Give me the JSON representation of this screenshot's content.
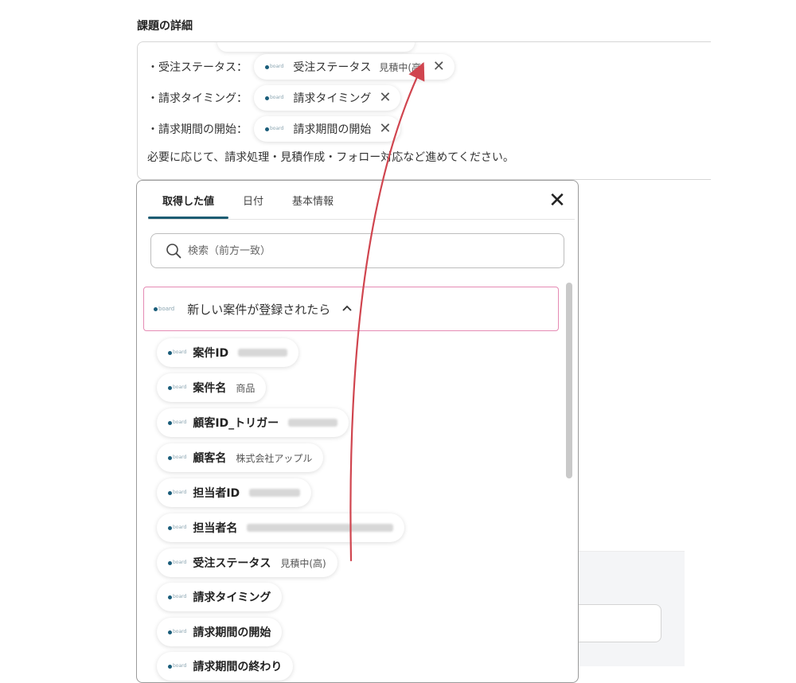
{
  "section_title": "課題の詳細",
  "detail": {
    "lines": [
      {
        "label": "・受注ステータス：",
        "pill": "受注ステータス",
        "sub": "見積中(高)"
      },
      {
        "label": "・請求タイミング：",
        "pill": "請求タイミング",
        "sub": ""
      },
      {
        "label": "・請求期間の開始：",
        "pill": "請求期間の開始",
        "sub": ""
      }
    ],
    "note": "必要に応じて、請求処理・見積作成・フォロー対応など進めてください。",
    "remove_glyph": "✕"
  },
  "logo_text": "board",
  "popup": {
    "tabs": [
      "取得した値",
      "日付",
      "基本情報"
    ],
    "active_tab": 0,
    "close_glyph": "✕",
    "search_placeholder": "検索（前方一致）",
    "group_title": "新しい案件が登録されたら",
    "group_chevron": "^",
    "items": [
      {
        "name": "案件ID",
        "value": ""
      },
      {
        "name": "案件名",
        "value": "商品"
      },
      {
        "name": "顧客ID_トリガー",
        "value": ""
      },
      {
        "name": "顧客名",
        "value": "株式会社アップル"
      },
      {
        "name": "担当者ID",
        "value": ""
      },
      {
        "name": "担当者名",
        "value": ""
      },
      {
        "name": "受注ステータス",
        "value": "見積中(高)"
      },
      {
        "name": "請求タイミング",
        "value": ""
      },
      {
        "name": "請求期間の開始",
        "value": ""
      },
      {
        "name": "請求期間の終わり",
        "value": ""
      }
    ]
  },
  "colors": {
    "accent_tab": "#1d5d73",
    "group_border": "#e58bb4",
    "arrow": "#d0454f"
  }
}
